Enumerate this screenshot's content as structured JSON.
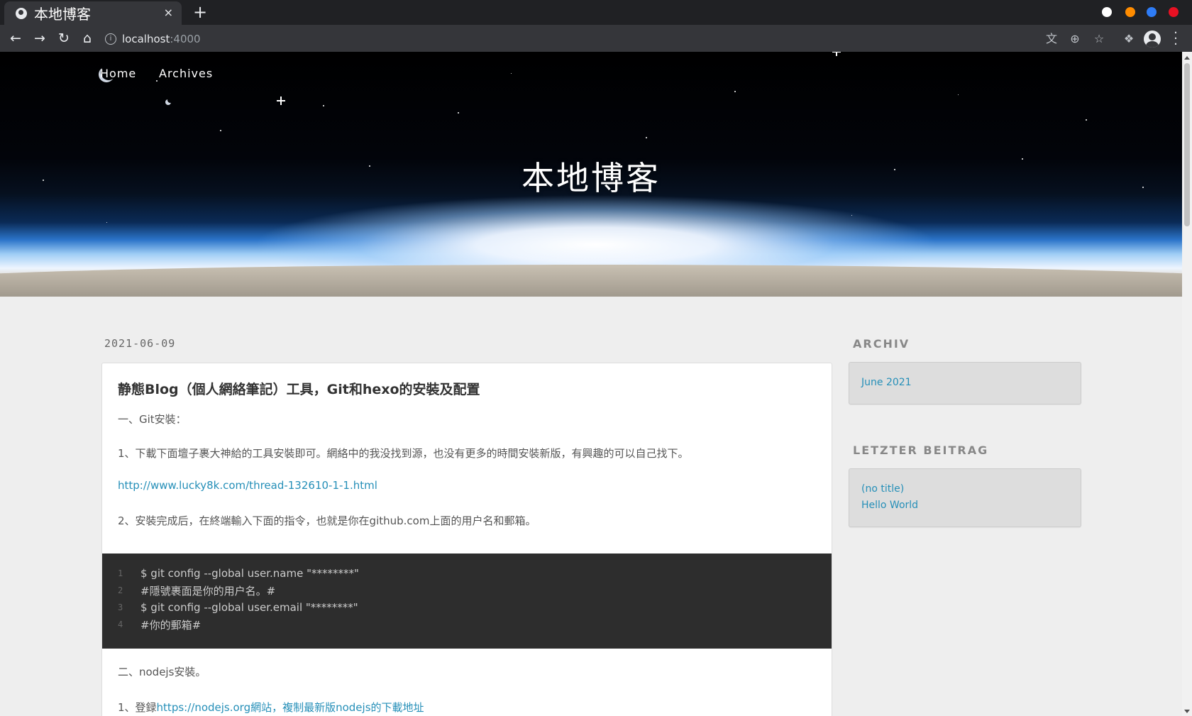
{
  "browser": {
    "tab_title": "本地博客",
    "tab_close": "×",
    "new_tab": "+",
    "url_host": "localhost",
    "url_port": ":4000",
    "window_controls_colors": [
      "#ff8c00",
      "#2e7cf6",
      "#e81123"
    ]
  },
  "site": {
    "title": "本地博客",
    "nav": [
      {
        "label": "Home"
      },
      {
        "label": "Archives"
      }
    ]
  },
  "post": {
    "date": "2021-06-09",
    "title": "静態Blog（個人網絡筆記）工具，Git和hexo的安裝及配置",
    "p1": "一、Git安裝：",
    "p2": "1、下載下面壇子裹大神給的工具安裝即可。網絡中的我没找到源，也没有更多的時間安裝新版，有興趣的可以自己找下。",
    "link": "http://www.lucky8k.com/thread-132610-1-1.html",
    "p3": "2、安裝完成后，在終端輸入下面的指令，也就是你在github.com上面的用户名和郵箱。",
    "code": [
      {
        "num": "1",
        "text": "$ git config --global user.name \"********\""
      },
      {
        "num": "2",
        "text": "#隱號裹面是你的用户名。#"
      },
      {
        "num": "3",
        "text": "$ git config --global user.email \"********\""
      },
      {
        "num": "4",
        "text": "#你的郵箱#"
      }
    ],
    "p4": "二、nodejs安裝。",
    "p5_prefix": "1、登録",
    "p5_link": "https://nodejs.org網站，複制最新版nodejs的下載地址"
  },
  "sidebar": {
    "archive_heading": "ARCHIV",
    "archive_items": [
      {
        "label": "June 2021"
      }
    ],
    "recent_heading": "LETZTER BEITRAG",
    "recent_items": [
      {
        "label": "(no title)"
      },
      {
        "label": "Hello World"
      }
    ]
  },
  "colors": {
    "link": "#258fb8",
    "code_bg": "#2d2d2d",
    "page_bg": "#eeeeee"
  }
}
